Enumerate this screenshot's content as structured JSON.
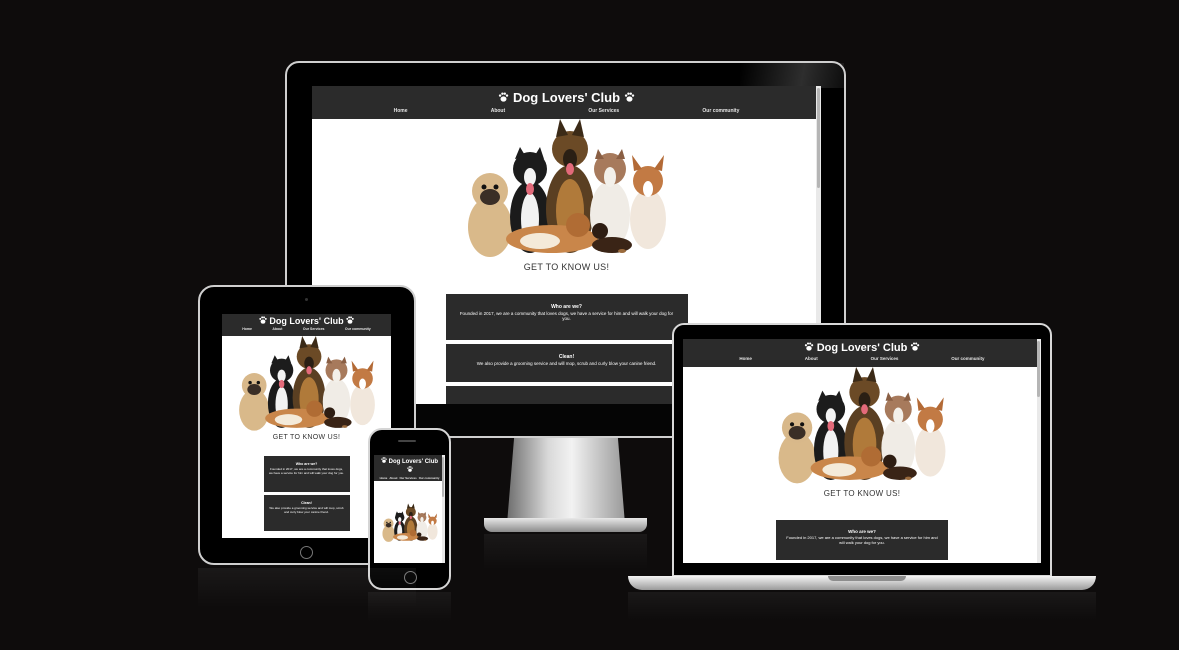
{
  "site": {
    "title": "Dog Lovers' Club",
    "paw_icon": "paw-icon",
    "nav": [
      "Home",
      "About",
      "Our Services",
      "Our community"
    ],
    "cta": "GET TO KNOW US!",
    "cards": [
      {
        "title": "Who are we?",
        "body": "Founded in 2017, we are a community that loves dogs, we have a service for him and will walk your dog for you."
      },
      {
        "title": "Clean!",
        "body": "We also provide a grooming service and will mop, scrub and curly blow your canine friend."
      }
    ]
  },
  "colors": {
    "page_background": "#0e0c0c",
    "header_background": "#2b2b2b",
    "card_background": "#2b2b2b",
    "text_on_dark": "#ffffff"
  },
  "devices": [
    "imac",
    "laptop",
    "tablet",
    "phone"
  ],
  "hero_image": "group-of-dogs-photo"
}
